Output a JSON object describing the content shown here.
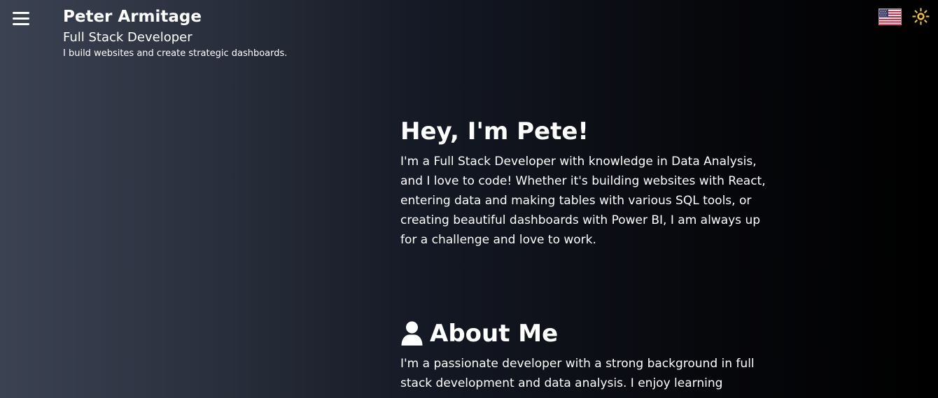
{
  "header": {
    "name": "Peter Armitage",
    "role": "Full Stack Developer",
    "tagline": "I build websites and create strategic dashboards."
  },
  "controls": {
    "menu_icon": "hamburger-menu-icon",
    "language_icon": "us-flag-icon",
    "theme_icon": "sun-icon",
    "theme_color": "#f5c518"
  },
  "hero": {
    "title": "Hey, I'm Pete!",
    "text": "I'm a Full Stack Developer with knowledge in Data Analysis, and I love to code! Whether it's building websites with React, entering data and making tables with various SQL tools, or creating beautiful dashboards with Power BI, I am always up for a challenge and love to work."
  },
  "about": {
    "icon": "user-icon",
    "title": "About Me",
    "text": "I'm a passionate developer with a strong background in full stack development and data analysis. I enjoy learning"
  }
}
